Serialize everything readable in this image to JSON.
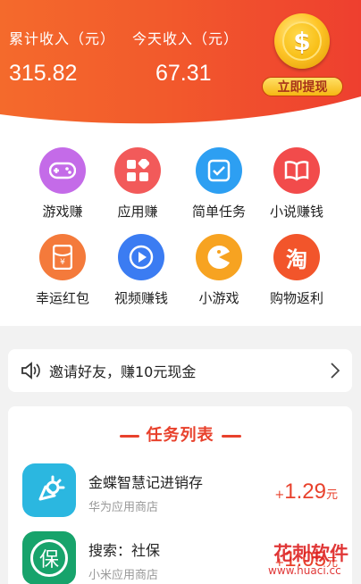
{
  "header": {
    "total_label": "累计收入（元）",
    "total_value": "315.82",
    "today_label": "今天收入（元）",
    "today_value": "67.31",
    "coin_symbol": "$",
    "withdraw_label": "立即提现",
    "colors": {
      "from": "#f46a2c",
      "to": "#ee3f2f"
    }
  },
  "categories": [
    {
      "label": "游戏赚",
      "icon": "gamepad-icon",
      "color": "#c46be8"
    },
    {
      "label": "应用赚",
      "icon": "apps-icon",
      "color": "#f25a5a"
    },
    {
      "label": "简单任务",
      "icon": "task-check-icon",
      "color": "#2d9ff2"
    },
    {
      "label": "小说赚钱",
      "icon": "book-icon",
      "color": "#f24b4b"
    },
    {
      "label": "幸运红包",
      "icon": "red-packet-icon",
      "color": "#f47a3b"
    },
    {
      "label": "视频赚钱",
      "icon": "play-icon",
      "color": "#3b7cf2"
    },
    {
      "label": "小游戏",
      "icon": "pacman-icon",
      "color": "#f7a321"
    },
    {
      "label": "购物返利",
      "icon": "taobao-icon",
      "color": "#f2552b",
      "glyph": "淘"
    }
  ],
  "invite": {
    "text": "邀请好友，赚10元现金",
    "icon": "speaker-icon"
  },
  "tasks": {
    "title": "任务列表",
    "items": [
      {
        "name": "金蝶智慧记进销存",
        "source": "华为应用商店",
        "plus": "+",
        "amount": "1.29",
        "unit": "元",
        "icon": "kingdee-app-icon",
        "color": "#2bb7e0"
      },
      {
        "name": "搜索：社保",
        "source": "小米应用商店",
        "plus": "+",
        "amount": "1.05",
        "unit": "元",
        "icon": "social-security-app-icon",
        "color": "#17a36b",
        "glyph": "保"
      }
    ]
  },
  "watermark": {
    "text": "花刺软件",
    "url": "www.huaci.cc"
  }
}
